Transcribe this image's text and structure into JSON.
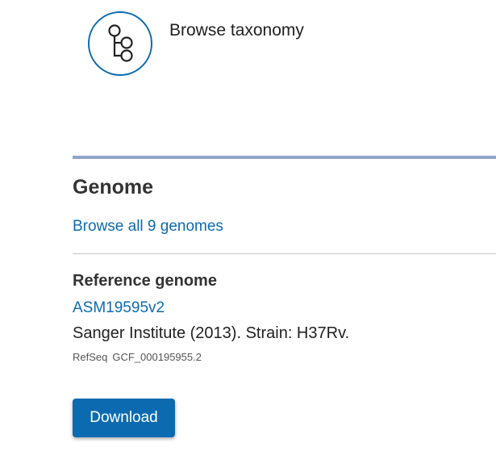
{
  "taxonomy": {
    "icon": "tree-hierarchy-icon",
    "label": "Browse taxonomy"
  },
  "genome": {
    "title": "Genome",
    "browse_link": "Browse all 9 genomes",
    "reference": {
      "heading": "Reference genome",
      "assembly_name": "ASM19595v2",
      "description": "Sanger Institute (2013). Strain: H37Rv.",
      "refseq_label": "RefSeq",
      "refseq_accession": "GCF_000195955.2"
    },
    "download_label": "Download"
  },
  "colors": {
    "link": "#0c6bb0",
    "button_bg": "#0c6bb0",
    "section_rule": "#8fa4c9"
  }
}
